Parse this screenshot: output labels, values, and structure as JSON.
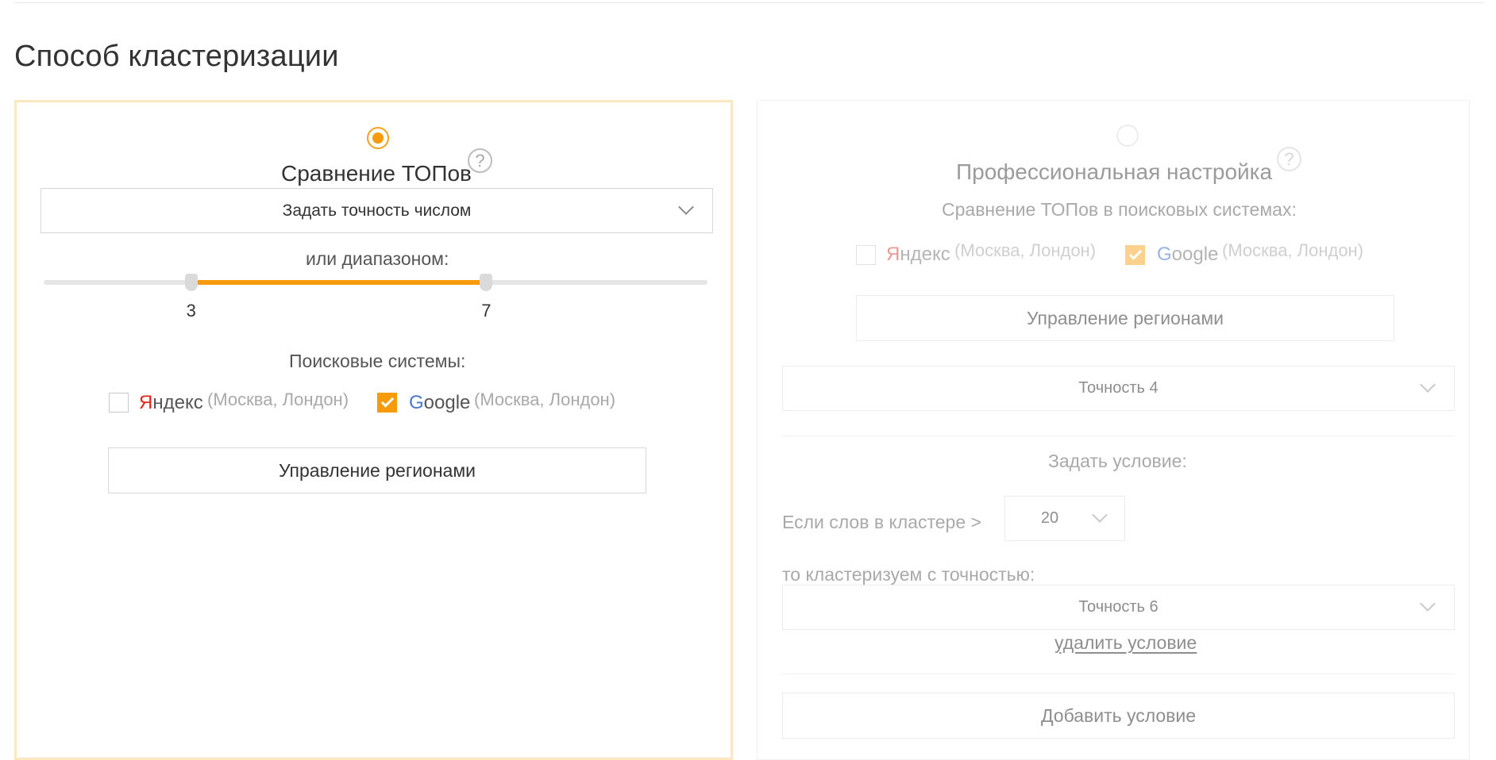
{
  "section_title": "Способ кластеризации",
  "left_card": {
    "title": "Сравнение ТОПов",
    "help": "?",
    "precision_select": "Задать точность числом",
    "range_label": "или диапазоном:",
    "slider": {
      "min": 1,
      "max": 10,
      "low": 3,
      "high": 7,
      "low_label": "3",
      "high_label": "7"
    },
    "engines_label": "Поисковые системы:",
    "engines": [
      {
        "first_letter": "Я",
        "name_rest": "ндекс",
        "regions": "(Москва, Лондон)",
        "checked": false
      },
      {
        "first_letter": "G",
        "name_rest": "oogle",
        "regions": "(Москва, Лондон)",
        "checked": true
      }
    ],
    "regions_button": "Управление регионами"
  },
  "right_card": {
    "title": "Профессиональная настройка",
    "help": "?",
    "subtitle": "Сравнение ТОПов в поисковых системах:",
    "engines": [
      {
        "first_letter": "Я",
        "name_rest": "ндекс",
        "regions": "(Москва, Лондон)",
        "checked": false
      },
      {
        "first_letter": "G",
        "name_rest": "oogle",
        "regions": "(Москва, Лондон)",
        "checked": true
      }
    ],
    "regions_button": "Управление регионами",
    "precision_select": "Точность 4",
    "condition_label": "Задать условие:",
    "words_label": "Если слов в кластере >",
    "words_select": "20",
    "then_label": "то кластеризуем с точностью:",
    "then_select": "Точность 6",
    "delete_link": "удалить условие",
    "add_button": "Добавить условие"
  },
  "colors": {
    "accent": "#f59b0c",
    "yandex_red": "#e2251b",
    "google_blue": "#4a77c8"
  }
}
